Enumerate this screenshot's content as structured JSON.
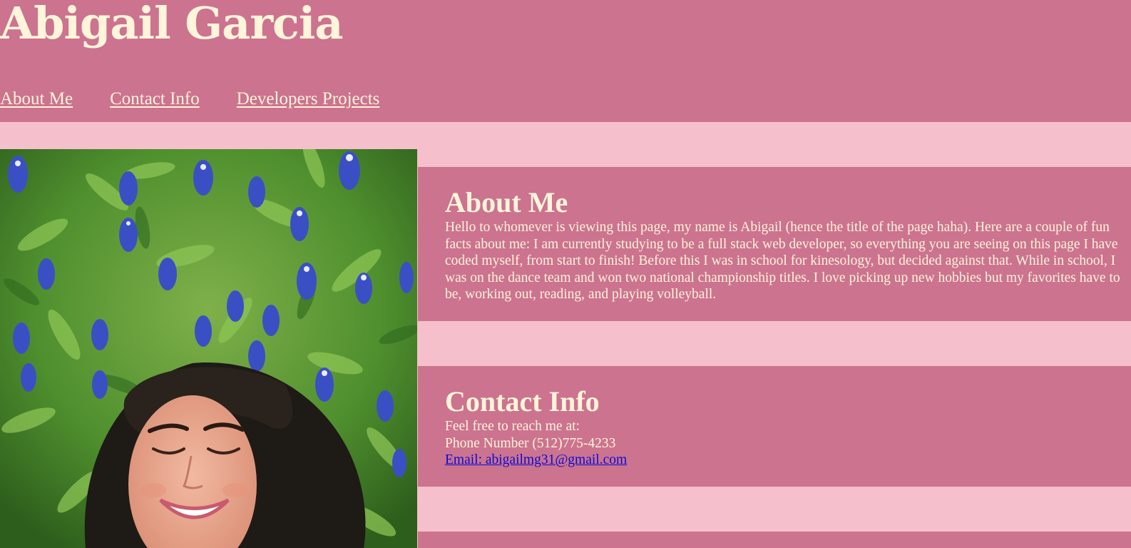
{
  "site": {
    "title": "Abigail Garcia"
  },
  "nav": {
    "items": [
      {
        "label": "About Me"
      },
      {
        "label": "Contact Info"
      },
      {
        "label": "Developers Projects"
      }
    ]
  },
  "about": {
    "heading": "About Me",
    "body": "Hello to whomever is viewing this page, my name is Abigail (hence the title of the page haha). Here are a couple of fun facts about me: I am currently studying to be a full stack web developer, so everything you are seeing on this page I have coded myself, from start to finish! Before this I was in school for kinesology, but decided against that. While in school, I was on the dance team and won two national championship titles. I love picking up new hobbies but my favorites have to be, working out, reading, and playing volleyball."
  },
  "contact": {
    "heading": "Contact Info",
    "intro": "Feel free to reach me at:",
    "phone": "Phone Number (512)775-4233",
    "email": "Email: abigailmg31@gmail.com"
  },
  "colors": {
    "header_bg": "#cc738f",
    "page_bg": "#f5c0cb",
    "text_cream": "#fff5da",
    "link_blue": "#0a0ad8"
  }
}
